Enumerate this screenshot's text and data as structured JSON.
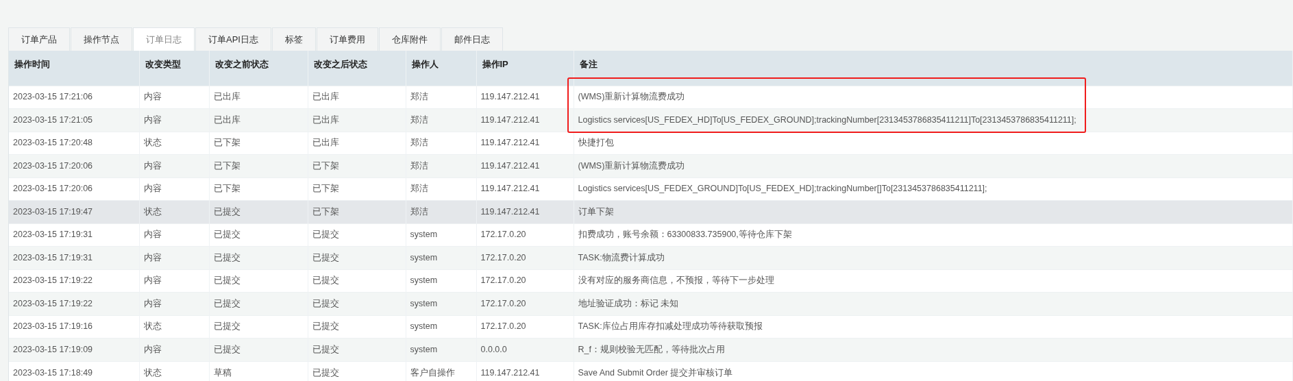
{
  "tabs": [
    {
      "label": "订单产品",
      "selected": false
    },
    {
      "label": "操作节点",
      "selected": false
    },
    {
      "label": "订单日志",
      "selected": true
    },
    {
      "label": "订单API日志",
      "selected": false
    },
    {
      "label": "标签",
      "selected": false
    },
    {
      "label": "订单费用",
      "selected": false
    },
    {
      "label": "仓库附件",
      "selected": false
    },
    {
      "label": "邮件日志",
      "selected": false
    }
  ],
  "table": {
    "columns": [
      "操作时间",
      "改变类型",
      "改变之前状态",
      "改变之后状态",
      "操作人",
      "操作IP",
      "备注"
    ],
    "rows": [
      {
        "cells": [
          "2023-03-15 17:21:06",
          "内容",
          "已出库",
          "已出库",
          "郑洁",
          "119.147.212.41",
          "(WMS)重新计算物流费成功"
        ],
        "selected": false,
        "boxed": true
      },
      {
        "cells": [
          "2023-03-15 17:21:05",
          "内容",
          "已出库",
          "已出库",
          "郑洁",
          "119.147.212.41",
          "Logistics services[US_FEDEX_HD]To[US_FEDEX_GROUND];trackingNumber[2313453786835411211]To[2313453786835411211];"
        ],
        "selected": false,
        "boxed": true
      },
      {
        "cells": [
          "2023-03-15 17:20:48",
          "状态",
          "已下架",
          "已出库",
          "郑洁",
          "119.147.212.41",
          "快捷打包"
        ],
        "selected": false,
        "boxed": false
      },
      {
        "cells": [
          "2023-03-15 17:20:06",
          "内容",
          "已下架",
          "已下架",
          "郑洁",
          "119.147.212.41",
          "(WMS)重新计算物流费成功"
        ],
        "selected": false,
        "boxed": false
      },
      {
        "cells": [
          "2023-03-15 17:20:06",
          "内容",
          "已下架",
          "已下架",
          "郑洁",
          "119.147.212.41",
          "Logistics services[US_FEDEX_GROUND]To[US_FEDEX_HD];trackingNumber[]To[2313453786835411211];"
        ],
        "selected": false,
        "boxed": false
      },
      {
        "cells": [
          "2023-03-15 17:19:47",
          "状态",
          "已提交",
          "已下架",
          "郑洁",
          "119.147.212.41",
          "订单下架"
        ],
        "selected": true,
        "boxed": false
      },
      {
        "cells": [
          "2023-03-15 17:19:31",
          "内容",
          "已提交",
          "已提交",
          "system",
          "172.17.0.20",
          "扣费成功，账号余额：63300833.735900,等待仓库下架"
        ],
        "selected": false,
        "boxed": false
      },
      {
        "cells": [
          "2023-03-15 17:19:31",
          "内容",
          "已提交",
          "已提交",
          "system",
          "172.17.0.20",
          "TASK:物流费计算成功"
        ],
        "selected": false,
        "boxed": false
      },
      {
        "cells": [
          "2023-03-15 17:19:22",
          "内容",
          "已提交",
          "已提交",
          "system",
          "172.17.0.20",
          "没有对应的服务商信息，不预报，等待下一步处理"
        ],
        "selected": false,
        "boxed": false
      },
      {
        "cells": [
          "2023-03-15 17:19:22",
          "内容",
          "已提交",
          "已提交",
          "system",
          "172.17.0.20",
          "地址验证成功：标记 未知"
        ],
        "selected": false,
        "boxed": false
      },
      {
        "cells": [
          "2023-03-15 17:19:16",
          "状态",
          "已提交",
          "已提交",
          "system",
          "172.17.0.20",
          "TASK:库位占用库存扣减处理成功等待获取预报"
        ],
        "selected": false,
        "boxed": false
      },
      {
        "cells": [
          "2023-03-15 17:19:09",
          "内容",
          "已提交",
          "已提交",
          "system",
          "0.0.0.0",
          "R_f：规则校验无匹配，等待批次占用"
        ],
        "selected": false,
        "boxed": false
      },
      {
        "cells": [
          "2023-03-15 17:18:49",
          "状态",
          "草稿",
          "已提交",
          "客户自操作",
          "119.147.212.41",
          "Save And Submit Order 提交并审核订单"
        ],
        "selected": false,
        "boxed": false
      }
    ]
  }
}
